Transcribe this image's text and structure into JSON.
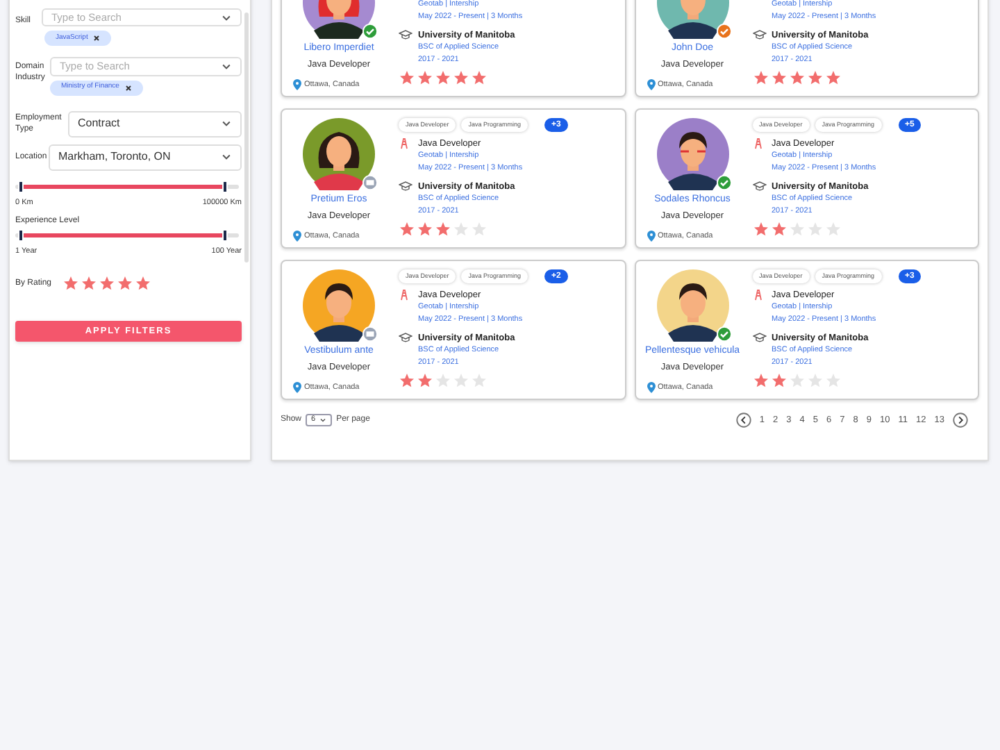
{
  "filters": {
    "skill": {
      "label": "Skill",
      "placeholder": "Type to Search",
      "chips": [
        "JavaScript"
      ]
    },
    "domain": {
      "label": "Domain Industry",
      "placeholder": "Type to Search",
      "chips": [
        "Ministry of Finance"
      ]
    },
    "employment": {
      "label": "Employment Type",
      "value": "Contract"
    },
    "location": {
      "label": "Location",
      "value": "Markham, Toronto, ON"
    },
    "distance": {
      "level": 1,
      "min_label": "0 Km",
      "max_label": "100000 Km"
    },
    "experience": {
      "label": "Experience Level",
      "level": 1,
      "min_label": "1 Year",
      "max_label": "100 Year"
    },
    "rating": {
      "label": "By Rating",
      "stars": 5
    },
    "apply_button": "APPLY FILTERS"
  },
  "candidates": [
    {
      "name": "Libero Imperdiet",
      "title": "Java Developer",
      "location": "Ottawa, Canada",
      "avatar": {
        "kind": "redhead",
        "color": "#a58ad0"
      },
      "badge": {
        "kind": "verified"
      },
      "job_company": "Geotab | Intership",
      "job_period": "May 2022 - Present | 3 Months",
      "school": "University of Manitoba",
      "degree": "BSC of Applied Science",
      "years": "2017 - 2021",
      "stars": 5
    },
    {
      "name": "John Doe",
      "title": "Java Developer",
      "location": "Ottawa, Canada",
      "avatar": {
        "kind": "man",
        "color": "#6fb8ae"
      },
      "badge": {
        "kind": "pending"
      },
      "job_company": "Geotab | Intership",
      "job_period": "May 2022 - Present | 3 Months",
      "school": "University of Manitoba",
      "degree": "BSC of Applied Science",
      "years": "2017 - 2021",
      "stars": 5
    },
    {
      "name": "Pretium Eros",
      "title": "Java Developer",
      "location": "Ottawa, Canada",
      "avatar": {
        "kind": "longhair",
        "color": "#7a9a2a"
      },
      "badge": {
        "kind": "work"
      },
      "tags": [
        "Java Developer",
        "Java Programming"
      ],
      "more": "+3",
      "job_title": "Java Developer",
      "job_company": "Geotab | Intership",
      "job_period": "May 2022 - Present | 3 Months",
      "school": "University of Manitoba",
      "degree": "BSC of Applied Science",
      "years": "2017 - 2021",
      "stars": 3
    },
    {
      "name": "Sodales Rhoncus",
      "title": "Java Developer",
      "location": "Ottawa, Canada",
      "avatar": {
        "kind": "glasses",
        "color": "#9b7fc8"
      },
      "badge": {
        "kind": "verified"
      },
      "tags": [
        "Java Developer",
        "Java Programming"
      ],
      "more": "+5",
      "job_title": "Java Developer",
      "job_company": "Geotab | Intership",
      "job_period": "May 2022 - Present | 3 Months",
      "school": "University of Manitoba",
      "degree": "BSC of Applied Science",
      "years": "2017 - 2021",
      "stars": 2
    },
    {
      "name": "Vestibulum ante",
      "title": "Java Developer",
      "location": "Ottawa, Canada",
      "avatar": {
        "kind": "man",
        "color": "#f5a623"
      },
      "badge": {
        "kind": "work"
      },
      "tags": [
        "Java Developer",
        "Java Programming"
      ],
      "more": "+2",
      "job_title": "Java Developer",
      "job_company": "Geotab | Intership",
      "job_period": "May 2022 - Present | 3 Months",
      "school": "University of Manitoba",
      "degree": "BSC of Applied Science",
      "years": "2017 - 2021",
      "stars": 2
    },
    {
      "name": "Pellentesque vehicula",
      "title": "Java Developer",
      "location": "Ottawa, Canada",
      "avatar": {
        "kind": "man",
        "color": "#f3d58a"
      },
      "badge": {
        "kind": "verified"
      },
      "tags": [
        "Java Developer",
        "Java Programming"
      ],
      "more": "+3",
      "job_title": "Java Developer",
      "job_company": "Geotab | Intership",
      "job_period": "May 2022 - Present | 3 Months",
      "school": "University of Manitoba",
      "degree": "BSC of Applied Science",
      "years": "2017 - 2021",
      "stars": 2
    }
  ],
  "pagination": {
    "show_label": "Show",
    "per_page_value": "6",
    "per_page_label": "Per page",
    "pages": [
      "1",
      "2",
      "3",
      "4",
      "5",
      "6",
      "7",
      "8",
      "9",
      "10",
      "11",
      "12",
      "13"
    ]
  }
}
